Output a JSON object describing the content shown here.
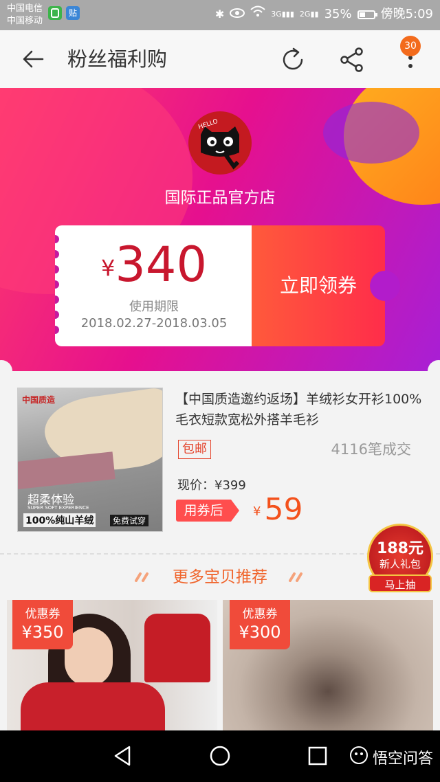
{
  "status_bar": {
    "carrier1": "中国电信",
    "carrier2": "中国移动",
    "app_icon2": "贴",
    "signal1": "3G",
    "signal2": "2G",
    "battery": "35%",
    "time": "傍晚5:09"
  },
  "nav": {
    "title": "粉丝福利购",
    "badge_count": "30"
  },
  "shop": {
    "logo_text": "HELLO",
    "name": "国际正品官方店"
  },
  "coupon": {
    "currency": "¥",
    "amount": "340",
    "limit_label": "使用期限",
    "dates": "2018.02.27-2018.03.05",
    "claim_label": "立即领券"
  },
  "product": {
    "brand": "中国质造",
    "img_caption1": "超柔体验",
    "img_caption2": "SUPER SOFT EXPERIENCE",
    "img_caption3": "100%纯山羊绒",
    "img_caption4": "免费试穿",
    "title": "【中国质造邀约返场】羊绒衫女开衫100%毛衣短款宽松外搭羊毛衫",
    "free_shipping": "包邮",
    "sold": "4116笔成交",
    "current_price": "现价：¥399",
    "coupon_after_label": "用券后",
    "final_currency": "¥",
    "final_price": "59"
  },
  "more_section": {
    "title": "更多宝贝推荐"
  },
  "cards": [
    {
      "tag_label": "优惠券",
      "tag_value": "¥350"
    },
    {
      "tag_label": "优惠券",
      "tag_value": "¥300"
    }
  ],
  "promo": {
    "amount": "188元",
    "sub": "新人礼包",
    "action": "马上抽"
  },
  "watermark": "悟空问答",
  "colors": {
    "accent": "#f3511c",
    "coupon_red": "#c8172e",
    "banner_start": "#ff3c69",
    "banner_end": "#a81fd5",
    "badge": "#f36b1c"
  }
}
